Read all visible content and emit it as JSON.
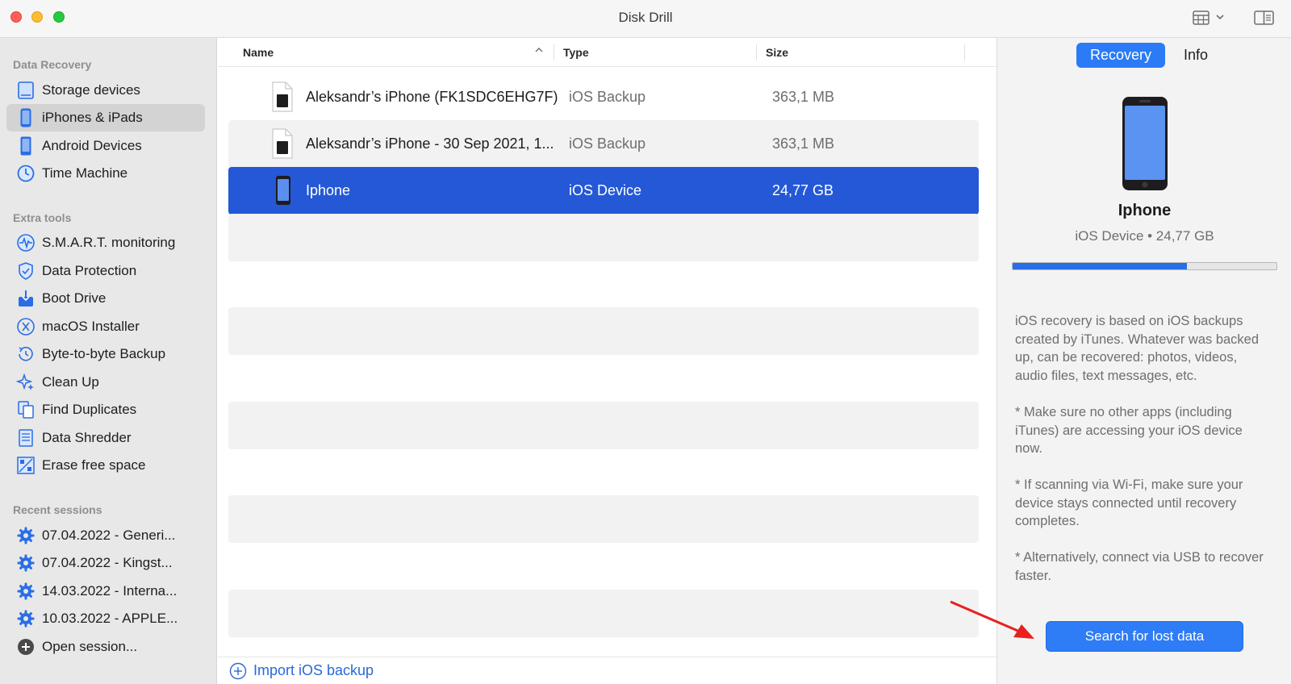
{
  "window": {
    "title": "Disk Drill"
  },
  "sidebar": {
    "sections": [
      {
        "title": "Data Recovery",
        "items": [
          {
            "label": "Storage devices",
            "icon": "hard-drive-icon",
            "selected": false
          },
          {
            "label": "iPhones & iPads",
            "icon": "iphone-icon",
            "selected": true
          },
          {
            "label": "Android Devices",
            "icon": "android-phone-icon",
            "selected": false
          },
          {
            "label": "Time Machine",
            "icon": "time-machine-icon",
            "selected": false
          }
        ]
      },
      {
        "title": "Extra tools",
        "items": [
          {
            "label": "S.M.A.R.T. monitoring",
            "icon": "pulse-icon"
          },
          {
            "label": "Data Protection",
            "icon": "shield-icon"
          },
          {
            "label": "Boot Drive",
            "icon": "boot-drive-icon"
          },
          {
            "label": "macOS Installer",
            "icon": "macos-x-icon"
          },
          {
            "label": "Byte-to-byte Backup",
            "icon": "clock-backup-icon"
          },
          {
            "label": "Clean Up",
            "icon": "sparkles-icon"
          },
          {
            "label": "Find Duplicates",
            "icon": "duplicate-files-icon"
          },
          {
            "label": "Data Shredder",
            "icon": "shredder-icon"
          },
          {
            "label": "Erase free space",
            "icon": "erase-space-icon"
          }
        ]
      },
      {
        "title": "Recent sessions",
        "items": [
          {
            "label": "07.04.2022 - Generi...",
            "icon": "gear-icon"
          },
          {
            "label": "07.04.2022 - Kingst...",
            "icon": "gear-icon"
          },
          {
            "label": "14.03.2022 - Interna...",
            "icon": "gear-icon"
          },
          {
            "label": "10.03.2022 - APPLE...",
            "icon": "gear-icon"
          },
          {
            "label": "Open session...",
            "icon": "plus-circle-icon"
          }
        ]
      }
    ]
  },
  "table": {
    "columns": {
      "name": "Name",
      "type": "Type",
      "size": "Size"
    },
    "rows": [
      {
        "name": "Aleksandr’s iPhone (FK1SDC6EHG7F)",
        "type": "iOS Backup",
        "size": "363,1 MB",
        "icon": "backup-file-icon"
      },
      {
        "name": "Aleksandr’s iPhone - 30 Sep 2021, 1...",
        "type": "iOS Backup",
        "size": "363,1 MB",
        "icon": "backup-file-icon"
      },
      {
        "name": "Iphone",
        "type": "iOS Device",
        "size": "24,77 GB",
        "icon": "iphone-icon",
        "selected": true
      }
    ],
    "import_label": "Import iOS backup"
  },
  "panel": {
    "tabs": {
      "active": "Recovery",
      "inactive": "Info"
    },
    "device_name": "Iphone",
    "device_sub": "iOS Device • 24,77 GB",
    "usage_fraction": 0.66,
    "paragraphs": [
      "iOS recovery is based on iOS backups created by iTunes. Whatever was backed up, can be recovered: photos, videos, audio files, text messages, etc.",
      "* Make sure no other apps (including iTunes) are accessing your iOS device now.",
      "* If scanning via Wi-Fi, make sure your device stays connected until recovery completes.",
      "* Alternatively, connect via USB to recover faster."
    ],
    "search_button": "Search for lost data"
  },
  "colors": {
    "accent": "#2a7bf5",
    "selection": "#2458d6",
    "annotation_arrow": "#e8201e"
  }
}
